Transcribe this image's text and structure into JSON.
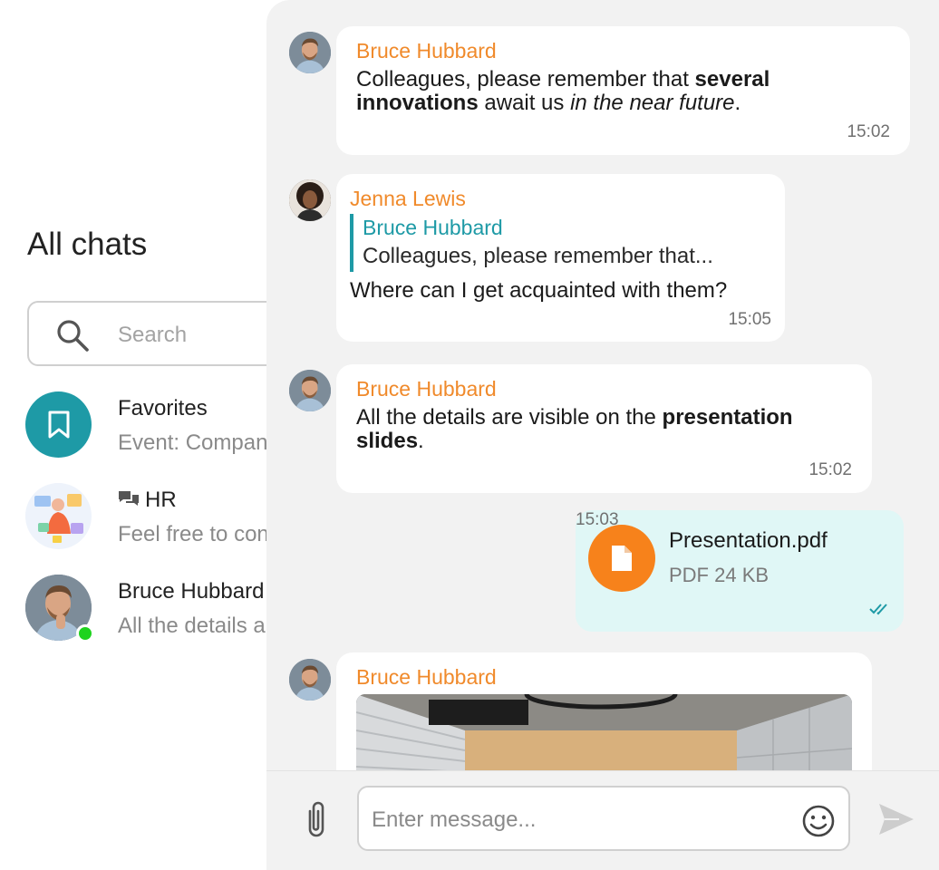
{
  "chat_list": {
    "title": "All chats",
    "search_placeholder": "Search",
    "items": [
      {
        "name": "Favorites",
        "preview": "Event: Company",
        "icon": "bookmark-icon"
      },
      {
        "name": "HR",
        "preview": "Feel free to contact",
        "icon": "group-chat-icon"
      },
      {
        "name": "Bruce Hubbard",
        "preview": "All the details are visible",
        "online": true
      }
    ]
  },
  "messages": [
    {
      "sender": "Bruce Hubbard",
      "text_parts": [
        "Colleagues, please remember that ",
        "several innovations",
        " await us ",
        "in the near future",
        "."
      ],
      "time": "15:02"
    },
    {
      "sender": "Jenna Lewis",
      "quote_author": "Bruce Hubbard",
      "quote_text": "Colleagues, please remember that...",
      "text": "Where can I get acquainted with them?",
      "time": "15:05"
    },
    {
      "sender": "Bruce Hubbard",
      "text_parts": [
        "All the details are visible on the ",
        "presentation slides",
        "."
      ],
      "time": "15:02"
    },
    {
      "file_name": "Presentation.pdf",
      "file_meta": "PDF 24 KB",
      "time": "15:03",
      "status": "read"
    },
    {
      "sender": "Bruce Hubbard",
      "attachment": "photo"
    }
  ],
  "composer": {
    "placeholder": "Enter message..."
  },
  "colors": {
    "accent_teal": "#1e9aa6",
    "sender_orange": "#f08a2b",
    "file_orange": "#f7821b",
    "online_green": "#1ed31e",
    "outgoing_bubble": "#e0f7f6"
  }
}
